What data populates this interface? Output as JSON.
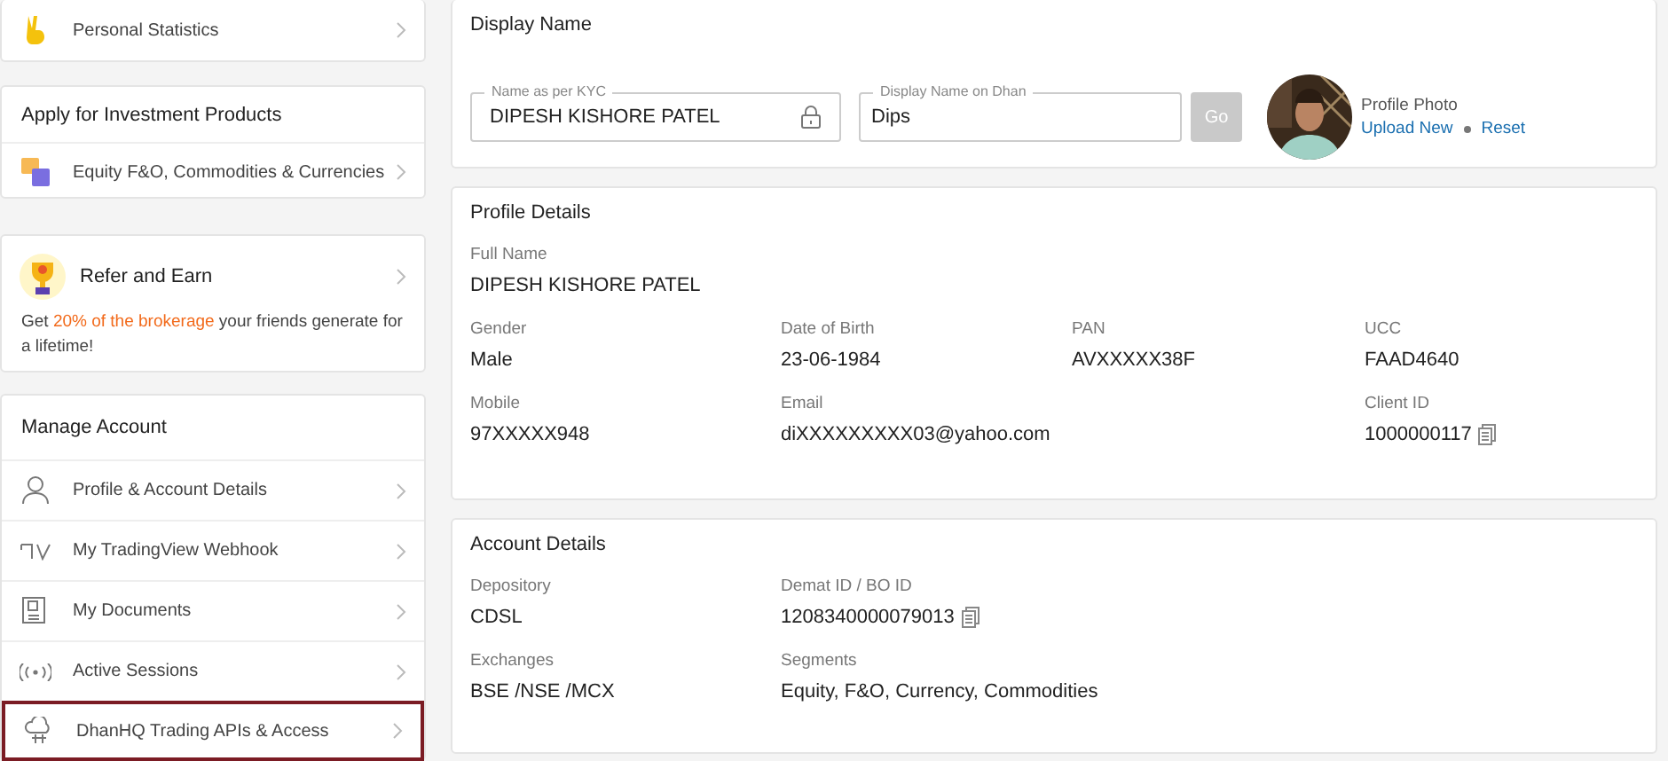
{
  "sidebar": {
    "personal_statistics": {
      "label": "Personal Statistics"
    },
    "investment": {
      "title": "Apply for Investment Products",
      "items": [
        {
          "label": "Equity F&O, Commodities & Currencies"
        }
      ]
    },
    "refer": {
      "title": "Refer and Earn",
      "text": "Get **20% of the brokerage** your friends generate for a lifetime!"
    },
    "manage": {
      "title": "Manage Account",
      "items": [
        {
          "label": "Profile & Account Details",
          "selected": false
        },
        {
          "label": "My TradingView Webhook",
          "selected": false
        },
        {
          "label": "My Documents",
          "selected": false
        },
        {
          "label": "Active Sessions",
          "selected": false
        },
        {
          "label": "DhanHQ Trading APIs & Access",
          "selected": true
        }
      ]
    }
  },
  "display_name": {
    "title": "Display Name",
    "kyc_field": {
      "label": "Name as per KYC",
      "value": "DIPESH KISHORE PATEL"
    },
    "display_field": {
      "label": "Display Name on Dhan",
      "value": "Dips"
    },
    "go_button": {
      "label": "Go",
      "disabled": true
    },
    "profile_photo": {
      "label": "Profile Photo",
      "links": [
        "Upload New",
        "Reset"
      ]
    }
  },
  "profile_details": {
    "title": "Profile Details",
    "rows": [
      [
        {
          "label": "Full Name",
          "value": "DIPESH KISHORE PATEL"
        }
      ],
      [
        {
          "label": "Gender",
          "value": "Male"
        },
        {
          "label": "Date of Birth",
          "value": "23-06-1984"
        },
        {
          "label": "PAN",
          "value": "AVXXXXX38F"
        },
        {
          "label": "UCC",
          "value": "FAAD4640"
        }
      ],
      [
        {
          "label": "Mobile",
          "value": "97XXXXX948"
        },
        {
          "label": "Email",
          "value": "diXXXXXXXXX03@yahoo.com"
        },
        "",
        {
          "label": "Client ID",
          "value": "1000000117",
          "copyable": true
        }
      ]
    ]
  },
  "account_details": {
    "title": "Account Details",
    "rows": [
      [
        {
          "label": "Depository",
          "value": "CDSL"
        },
        {
          "label": "Demat ID / BO ID",
          "value": "1208340000079013",
          "copyable": true
        }
      ],
      [
        {
          "label": "Exchanges",
          "value": "BSE /NSE /MCX"
        },
        {
          "label": "Segments",
          "value": "Equity, F&O, Currency, Commodities"
        }
      ]
    ]
  }
}
